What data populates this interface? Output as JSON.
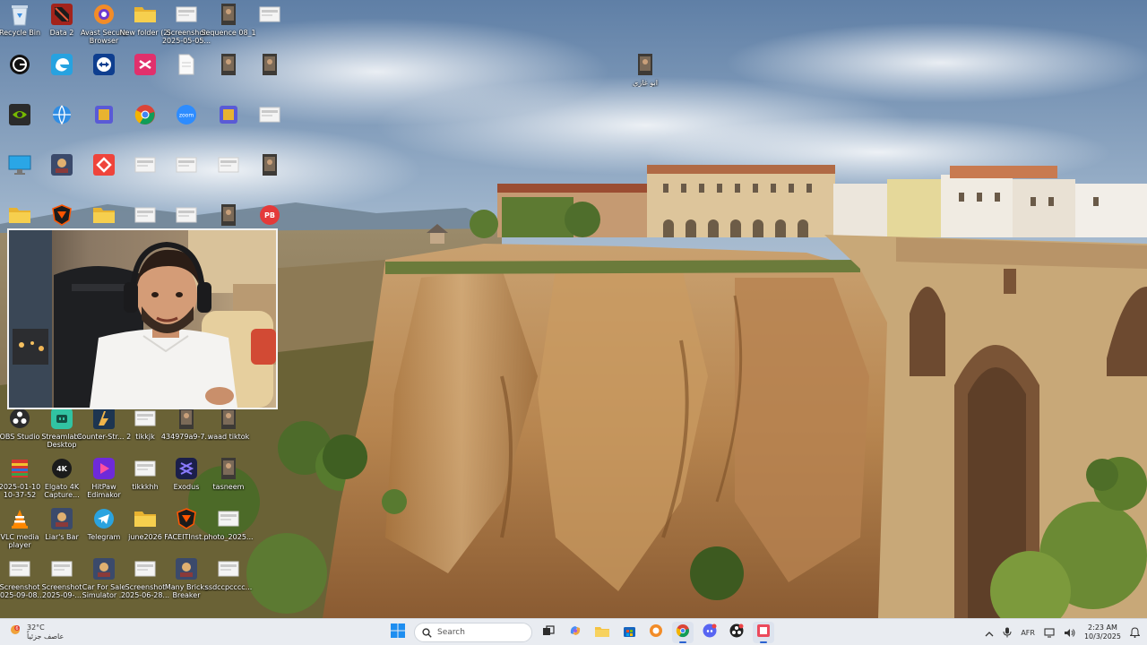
{
  "desktop": {
    "icons": [
      {
        "label": "Recycle Bin",
        "icon": "recycle-bin-icon"
      },
      {
        "label": "Data 2",
        "icon": "dota-game-icon"
      },
      {
        "label": "Avast Secure Browser",
        "icon": "avast-browser-icon"
      },
      {
        "label": "New folder (2)",
        "icon": "folder-icon"
      },
      {
        "label": "Screenshot 2025-05-05...",
        "icon": "image-file-icon"
      },
      {
        "label": "Sequence 08_1",
        "icon": "video-file-icon"
      },
      {
        "label": "",
        "icon": "image-file-icon"
      },
      {
        "label": "",
        "icon": "gog-galaxy-icon"
      },
      {
        "label": "",
        "icon": "microsoft-edge-icon"
      },
      {
        "label": "",
        "icon": "teamviewer-icon"
      },
      {
        "label": "",
        "icon": "capcut-icon"
      },
      {
        "label": "",
        "icon": "text-file-icon"
      },
      {
        "label": "",
        "icon": "video-file-icon"
      },
      {
        "label": "",
        "icon": "video-file-icon"
      },
      {
        "label": "",
        "icon": "nvidia-icon"
      },
      {
        "label": "",
        "icon": "network-app-icon"
      },
      {
        "label": "",
        "icon": "app-icon"
      },
      {
        "label": "",
        "icon": "chrome-icon"
      },
      {
        "label": "",
        "icon": "zoom-icon"
      },
      {
        "label": "",
        "icon": "app-icon"
      },
      {
        "label": "",
        "icon": "image-file-icon"
      },
      {
        "label": "",
        "icon": "monitor-icon"
      },
      {
        "label": "",
        "icon": "game-icon"
      },
      {
        "label": "",
        "icon": "anydesk-icon"
      },
      {
        "label": "",
        "icon": "image-file-icon"
      },
      {
        "label": "",
        "icon": "image-file-icon"
      },
      {
        "label": "",
        "icon": "image-file-icon"
      },
      {
        "label": "",
        "icon": "video-file-icon"
      },
      {
        "label": "",
        "icon": "folder-icon"
      },
      {
        "label": "",
        "icon": "faceit-icon"
      },
      {
        "label": "",
        "icon": "folder-icon"
      },
      {
        "label": "",
        "icon": "image-file-icon"
      },
      {
        "label": "",
        "icon": "image-file-icon"
      },
      {
        "label": "",
        "icon": "video-file-icon"
      },
      {
        "label": "",
        "icon": "pdf-icon"
      },
      {
        "label": "OBS Studio",
        "icon": "obs-icon"
      },
      {
        "label": "Streamlabs Desktop",
        "icon": "streamlabs-icon"
      },
      {
        "label": "Counter-Str... 2",
        "icon": "counter-strike-icon"
      },
      {
        "label": "tikkjk",
        "icon": "image-file-icon"
      },
      {
        "label": "434979a9-7...",
        "icon": "video-file-icon"
      },
      {
        "label": "waad tiktok",
        "icon": "video-file-icon"
      },
      {
        "label": "2025-01-10 10-37-52",
        "icon": "archive-icon"
      },
      {
        "label": "Elgato 4K Capture...",
        "icon": "elgato-icon"
      },
      {
        "label": "HitPaw Edimakor",
        "icon": "hitpaw-icon"
      },
      {
        "label": "tikkkhh",
        "icon": "image-file-icon"
      },
      {
        "label": "Exodus",
        "icon": "exodus-icon"
      },
      {
        "label": "tasneem",
        "icon": "video-file-icon"
      },
      {
        "label": "VLC media player",
        "icon": "vlc-icon"
      },
      {
        "label": "Liar's Bar",
        "icon": "game-icon"
      },
      {
        "label": "Telegram",
        "icon": "telegram-icon"
      },
      {
        "label": "june2026",
        "icon": "folder-icon"
      },
      {
        "label": "FACEITInst...",
        "icon": "faceit-icon"
      },
      {
        "label": "photo_2025...",
        "icon": "image-file-icon"
      },
      {
        "label": "Screenshot 2025-09-08...",
        "icon": "image-file-icon"
      },
      {
        "label": "Screenshot 2025-09-...",
        "icon": "image-file-icon"
      },
      {
        "label": "Car For Sale Simulator ...",
        "icon": "game-icon"
      },
      {
        "label": "Screenshot 2025-06-28...",
        "icon": "image-file-icon"
      },
      {
        "label": "Many Bricks Breaker",
        "icon": "game-icon"
      },
      {
        "label": "ssdccpcccc...",
        "icon": "image-file-icon"
      },
      {
        "label": "ابو غازي",
        "icon": "video-file-icon"
      }
    ]
  },
  "taskbar": {
    "weather": {
      "temp": "32°C",
      "condition": "عاصف جزئياً",
      "icon": "weather-icon"
    },
    "search_placeholder": "Search",
    "pinned": [
      {
        "icon": "windows-start-icon"
      },
      {
        "icon": "task-view-icon"
      },
      {
        "icon": "copilot-icon"
      },
      {
        "icon": "file-explorer-icon"
      },
      {
        "icon": "store-icon"
      },
      {
        "icon": "avast-browser-icon"
      },
      {
        "icon": "chrome-icon"
      },
      {
        "icon": "discord-icon"
      },
      {
        "icon": "obs-icon"
      },
      {
        "icon": "app-icon"
      }
    ],
    "tray": {
      "language": "AFR",
      "time": "2:23 AM",
      "date": "10/3/2025"
    }
  },
  "colors": {
    "taskbar_bg": "#e9ecf1",
    "accent": "#2a62d0"
  }
}
